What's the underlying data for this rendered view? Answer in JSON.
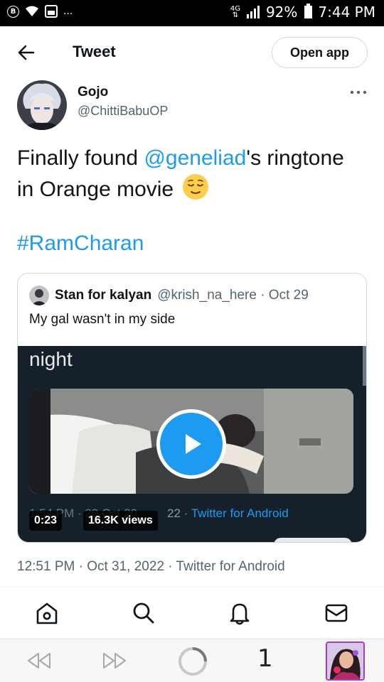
{
  "status_bar": {
    "left_badge": "B",
    "dots": "...",
    "network": "4G",
    "battery": "92%",
    "time": "7:44 PM"
  },
  "header": {
    "title": "Tweet",
    "open_app_label": "Open app"
  },
  "tweet": {
    "author_name": "Gojo",
    "author_handle": "@ChittiBabuOP",
    "text_part1": "Finally found ",
    "mention": "@geneliad",
    "text_part2": "'s ringtone in Orange movie",
    "hashtag": "#RamCharan",
    "timestamp": "12:51 PM · Oct 31, 2022 · Twitter for Android"
  },
  "quote": {
    "name": "Stan for kalyan",
    "handle_date": "@krish_na_here · Oct 29",
    "text": "My gal wasn't in my side",
    "media": {
      "overlay_word": "night",
      "ghost_meta": "1:54 PM · 29 Oct 20",
      "meta_suffix_num": "22",
      "meta_dot": " · ",
      "meta_source": "Twitter for Android",
      "duration": "0:23",
      "views": "16.3K views"
    }
  },
  "browser": {
    "tab_count": "1"
  },
  "colors": {
    "accent": "#1d9bf0",
    "text": "#0f1419",
    "secondary": "#536471"
  }
}
